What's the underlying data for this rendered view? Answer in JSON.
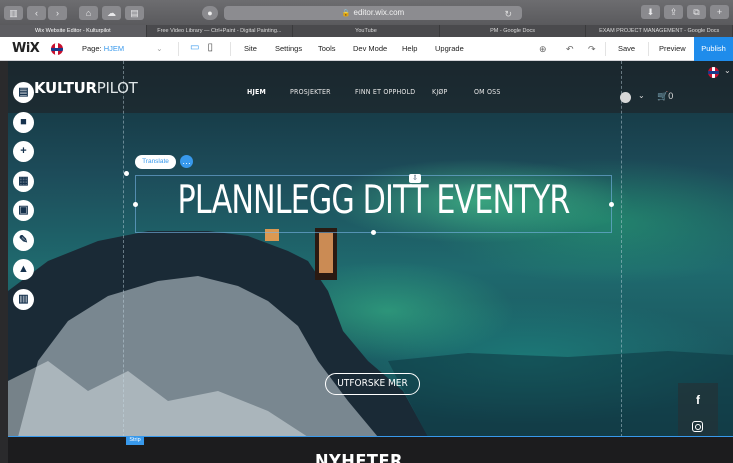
{
  "browser": {
    "url": "editor.wix.com",
    "tabs": [
      {
        "title": "Wix Website Editor - Kulturpilot",
        "active": true
      },
      {
        "title": "Free Video Library — Ctrl+Paint - Digital Painting...",
        "active": false
      },
      {
        "title": "YouTube",
        "active": false
      },
      {
        "title": "PM - Google Docs",
        "active": false
      },
      {
        "title": "EXAM PROJECT MANAGEMENT - Google Docs",
        "active": false
      }
    ]
  },
  "wix_topbar": {
    "logo": "WiX",
    "page_label": "Page:",
    "page_value": "HJEM",
    "menu": [
      "Site",
      "Settings",
      "Tools",
      "Dev Mode",
      "Help",
      "Upgrade"
    ],
    "save": "Save",
    "preview": "Preview",
    "publish": "Publish"
  },
  "site": {
    "logo_bold": "KULTUR",
    "logo_thin": "PILOT",
    "nav": [
      "HJEM",
      "PROSJEKTER",
      "FINN ET OPPHOLD",
      "KJØP",
      "OM OSS"
    ],
    "cart_count": "0",
    "translate_button": "Translate",
    "headline": "PLANNLEGG DITT EVENTYR",
    "cta": "UTFORSKE MER",
    "next_section_title": "NYHETER",
    "strip_label": "Strip"
  },
  "left_tools": [
    "menus-pages-icon",
    "background-icon",
    "add-icon",
    "add-apps-icon",
    "media-icon",
    "pen-icon",
    "store-icon",
    "my-business-icon"
  ]
}
